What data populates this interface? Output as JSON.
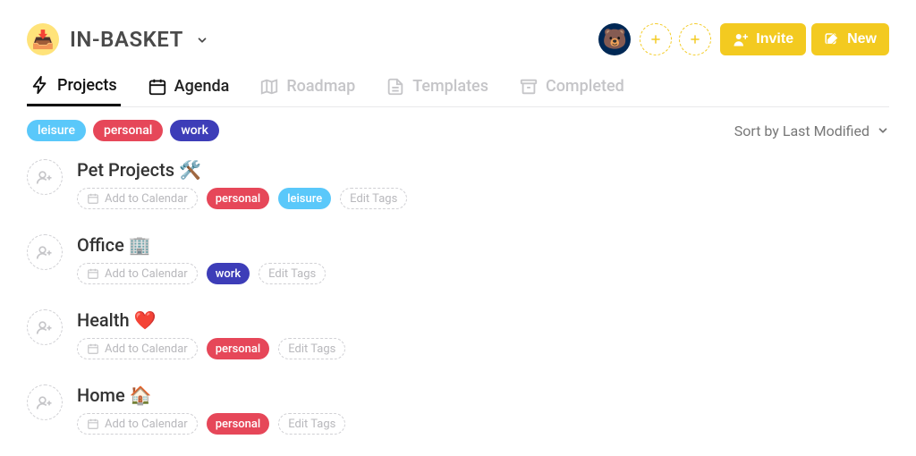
{
  "workspace": {
    "title": "IN-BASKET",
    "icon": "📥"
  },
  "header": {
    "invite_label": "Invite",
    "new_label": "New"
  },
  "tabs": [
    {
      "id": "projects",
      "label": "Projects",
      "active": true,
      "enabled": true
    },
    {
      "id": "agenda",
      "label": "Agenda",
      "active": false,
      "enabled": true
    },
    {
      "id": "roadmap",
      "label": "Roadmap",
      "active": false,
      "enabled": false
    },
    {
      "id": "templates",
      "label": "Templates",
      "active": false,
      "enabled": false
    },
    {
      "id": "completed",
      "label": "Completed",
      "active": false,
      "enabled": false
    }
  ],
  "filters": {
    "tags": [
      {
        "label": "leisure",
        "kind": "leisure"
      },
      {
        "label": "personal",
        "kind": "personal"
      },
      {
        "label": "work",
        "kind": "work"
      }
    ],
    "sort_label": "Sort by Last Modified"
  },
  "strings": {
    "add_to_calendar": "Add to Calendar",
    "edit_tags": "Edit Tags"
  },
  "projects": [
    {
      "title": "Pet Projects 🛠️",
      "tags": [
        {
          "label": "personal",
          "kind": "personal"
        },
        {
          "label": "leisure",
          "kind": "leisure"
        }
      ]
    },
    {
      "title": "Office 🏢",
      "tags": [
        {
          "label": "work",
          "kind": "work"
        }
      ]
    },
    {
      "title": "Health ❤️",
      "tags": [
        {
          "label": "personal",
          "kind": "personal"
        }
      ]
    },
    {
      "title": "Home 🏠",
      "tags": [
        {
          "label": "personal",
          "kind": "personal"
        }
      ]
    }
  ]
}
